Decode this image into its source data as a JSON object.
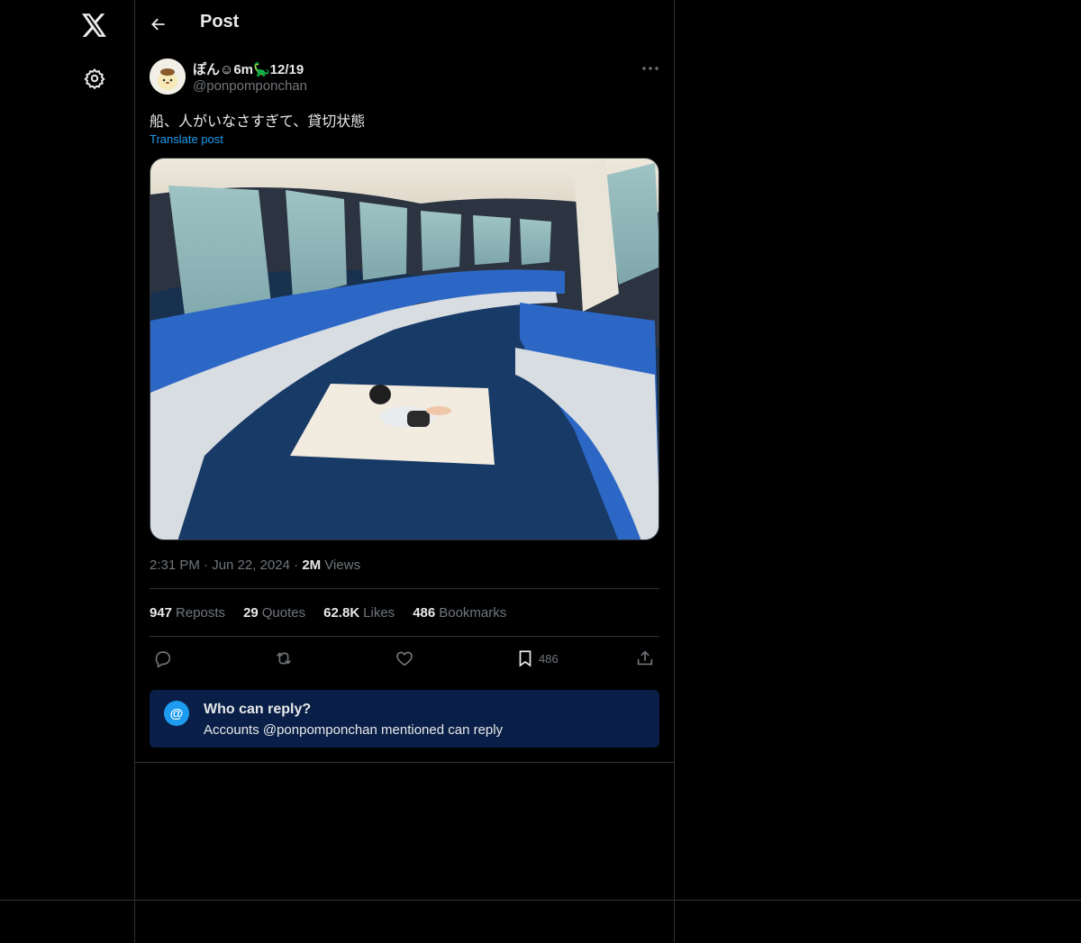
{
  "header": {
    "title": "Post"
  },
  "post": {
    "display_name": "ぽん☺6m🦕12/19",
    "handle": "@ponpomponchan",
    "text": "船、人がいなさすぎて、貸切状態",
    "translate_label": "Translate post",
    "time": "2:31 PM",
    "date": "Jun 22, 2024",
    "views_count": "2M",
    "views_label": "Views"
  },
  "stats": {
    "reposts_count": "947",
    "reposts_label": "Reposts",
    "quotes_count": "29",
    "quotes_label": "Quotes",
    "likes_count": "62.8K",
    "likes_label": "Likes",
    "bookmarks_count": "486",
    "bookmarks_label": "Bookmarks"
  },
  "actions": {
    "bookmark_count": "486"
  },
  "reply_notice": {
    "title": "Who can reply?",
    "subtitle": "Accounts @ponpomponchan mentioned can reply",
    "icon": "@"
  },
  "colors": {
    "accent": "#1d9bf0",
    "notice_bg": "#0a1f47",
    "border": "#2f3336",
    "muted": "#71767b"
  }
}
